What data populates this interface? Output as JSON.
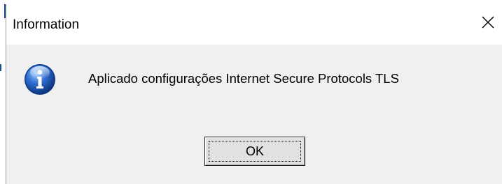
{
  "window": {
    "title": "Information",
    "close_icon": "close-icon"
  },
  "dialog": {
    "icon": "info-icon",
    "message": "Aplicado configurações Internet Secure Protocols TLS",
    "ok_label": "OK"
  },
  "colors": {
    "title_bar": "#ffffff",
    "dialog_body": "#f0f0f0",
    "icon_blue": "#1f5fb8",
    "button_face": "#e1e1e1"
  }
}
